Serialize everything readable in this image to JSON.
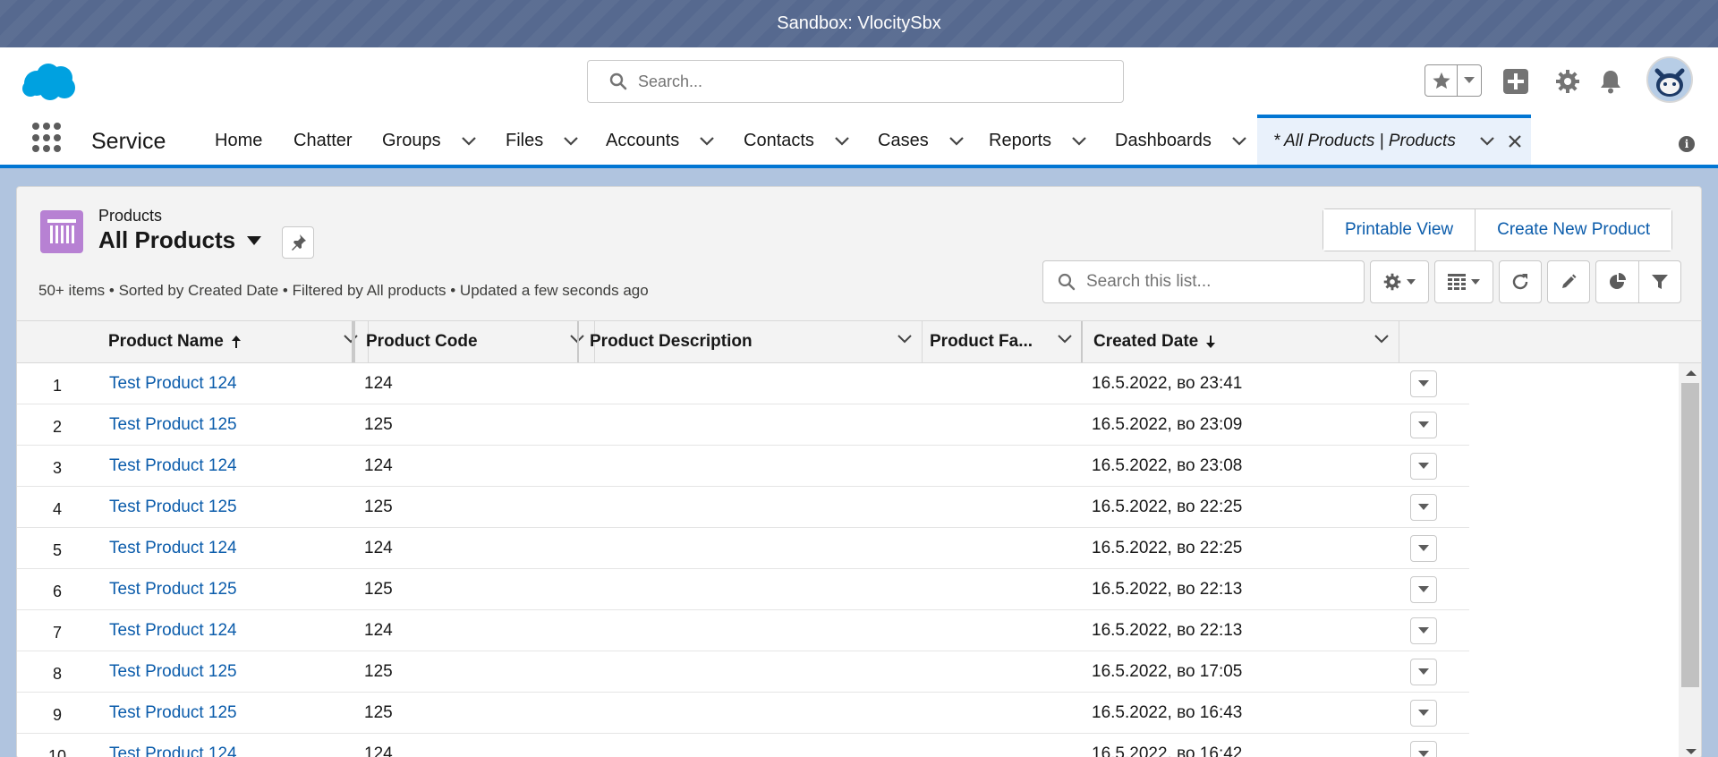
{
  "banner": {
    "text": "Sandbox: VlocitySbx"
  },
  "header": {
    "search_placeholder": "Search..."
  },
  "nav": {
    "app_name": "Service",
    "items": [
      {
        "label": "Home",
        "has_menu": false
      },
      {
        "label": "Chatter",
        "has_menu": false
      },
      {
        "label": "Groups",
        "has_menu": true
      },
      {
        "label": "Files",
        "has_menu": true
      },
      {
        "label": "Accounts",
        "has_menu": true
      },
      {
        "label": "Contacts",
        "has_menu": true
      },
      {
        "label": "Cases",
        "has_menu": true
      },
      {
        "label": "Reports",
        "has_menu": true
      },
      {
        "label": "Dashboards",
        "has_menu": true
      }
    ],
    "active_tab": "* All Products | Products"
  },
  "list_view": {
    "object_label": "Products",
    "title": "All Products",
    "meta": "50+ items • Sorted by Created Date • Filtered by All products • Updated a few seconds ago",
    "buttons": {
      "printable": "Printable View",
      "create": "Create New Product"
    },
    "search_placeholder": "Search this list..."
  },
  "table": {
    "columns": [
      "Product Name",
      "Product Code",
      "Product Description",
      "Product Fa...",
      "Created Date"
    ],
    "rows": [
      {
        "num": "1",
        "name": "Test Product 124",
        "code": "124",
        "date": "16.5.2022, во 23:41"
      },
      {
        "num": "2",
        "name": "Test Product 125",
        "code": "125",
        "date": "16.5.2022, во 23:09"
      },
      {
        "num": "3",
        "name": "Test Product 124",
        "code": "124",
        "date": "16.5.2022, во 23:08"
      },
      {
        "num": "4",
        "name": "Test Product 125",
        "code": "125",
        "date": "16.5.2022, во 22:25"
      },
      {
        "num": "5",
        "name": "Test Product 124",
        "code": "124",
        "date": "16.5.2022, во 22:25"
      },
      {
        "num": "6",
        "name": "Test Product 125",
        "code": "125",
        "date": "16.5.2022, во 22:13"
      },
      {
        "num": "7",
        "name": "Test Product 124",
        "code": "124",
        "date": "16.5.2022, во 22:13"
      },
      {
        "num": "8",
        "name": "Test Product 125",
        "code": "125",
        "date": "16.5.2022, во 17:05"
      },
      {
        "num": "9",
        "name": "Test Product 125",
        "code": "125",
        "date": "16.5.2022, во 16:43"
      },
      {
        "num": "10",
        "name": "Test Product 124",
        "code": "124",
        "date": "16.5.2022, во 16:42"
      }
    ]
  },
  "colors": {
    "brand": "#0176d3",
    "link": "#0b5cab",
    "banner": "#56698f",
    "object_icon": "#b781d3"
  },
  "icons": [
    "salesforce-cloud-icon",
    "search-icon",
    "star-icon",
    "add-icon",
    "gear-icon",
    "bell-icon",
    "waffle-icon",
    "chevron-down-icon",
    "close-icon",
    "info-icon",
    "product-icon",
    "pin-icon",
    "refresh-icon",
    "pencil-icon",
    "pie-chart-icon",
    "filter-icon",
    "table-icon"
  ]
}
